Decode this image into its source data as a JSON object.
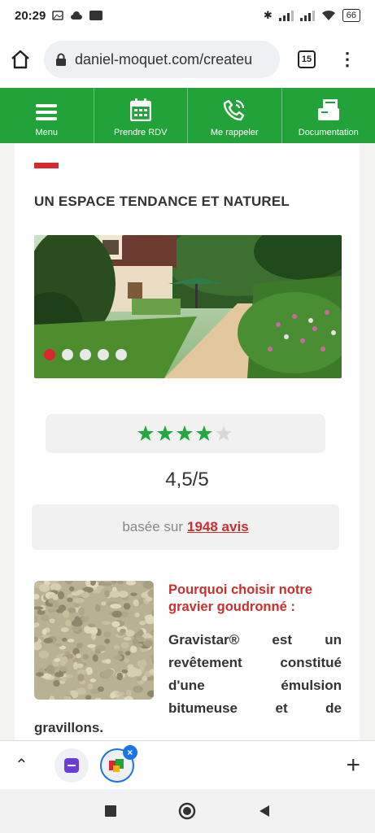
{
  "status_bar": {
    "time": "20:29",
    "battery": "66"
  },
  "browser": {
    "url": "daniel-moquet.com/createu",
    "tab_count": "15"
  },
  "nav": {
    "items": [
      {
        "label": "Menu",
        "icon": "menu-icon"
      },
      {
        "label": "Prendre RDV",
        "icon": "calendar-icon"
      },
      {
        "label": "Me rappeler",
        "icon": "phone-icon"
      },
      {
        "label": "Documentation",
        "icon": "documents-icon"
      }
    ]
  },
  "content": {
    "subtitle": "UN ESPACE TENDANCE ET NATUREL",
    "carousel": {
      "slide_count": 5,
      "active_index": 0
    },
    "rating": {
      "value": 4.5,
      "max": 5,
      "stars_text": "★★★★★"
    },
    "score_text": "4,5/5",
    "based_on_prefix": "basée sur",
    "reviews_link": "1948 avis",
    "why_heading": "Pourquoi choisir notre gravier goudronné :",
    "description": "Gravistar® est un revêtement constitué d'une émulsion bitumeuse et de",
    "description_tail": "gravillons."
  },
  "colors": {
    "brand_green": "#22a33a",
    "accent_red": "#d9262f",
    "star_green": "#1fa83b"
  }
}
